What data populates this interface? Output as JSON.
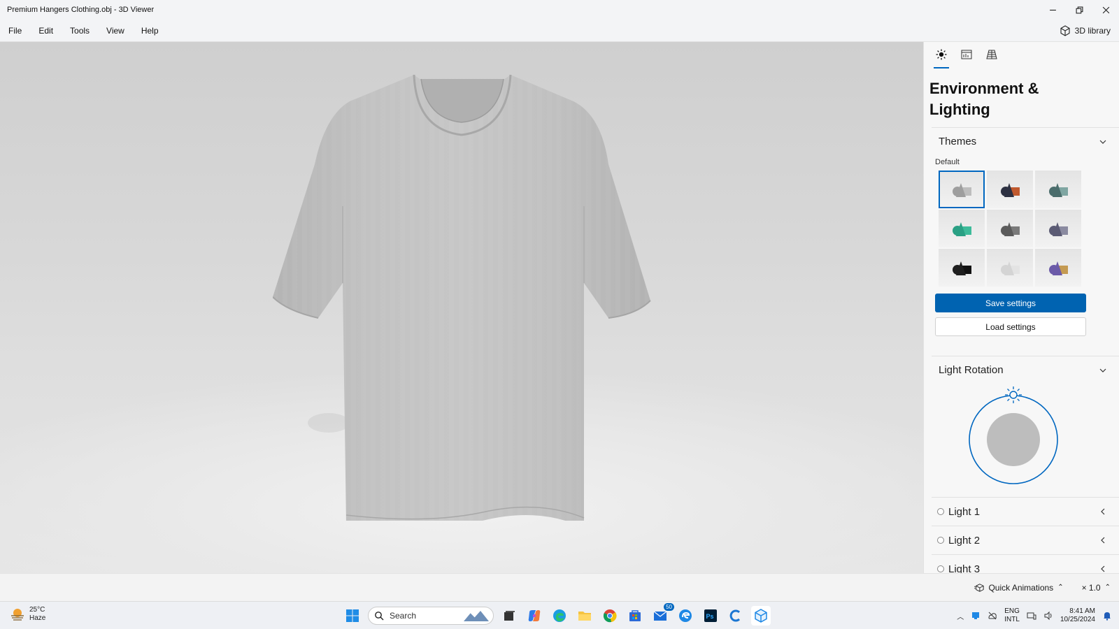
{
  "window": {
    "title": "Premium Hangers Clothing.obj - 3D Viewer",
    "controls": [
      "minimize",
      "restore",
      "close"
    ]
  },
  "menu": {
    "items": [
      "File",
      "Edit",
      "Tools",
      "View",
      "Help"
    ],
    "library_label": "3D library"
  },
  "panel": {
    "tabs": [
      "sun-icon",
      "stats-icon",
      "grid-icon"
    ],
    "title": "Environment & Lighting",
    "themes": {
      "label": "Themes",
      "subtitle": "Default",
      "items": [
        {
          "name": "theme-grey",
          "primary": "#9e9e9e",
          "secondary": "#bdbdbd"
        },
        {
          "name": "theme-dark-orange",
          "primary": "#2d3142",
          "secondary": "#c0592e"
        },
        {
          "name": "theme-teal-grey",
          "primary": "#4b6d6c",
          "secondary": "#7fa6a2"
        },
        {
          "name": "theme-green",
          "primary": "#2aa084",
          "secondary": "#3dbb9a"
        },
        {
          "name": "theme-dark-grey",
          "primary": "#5a5a5a",
          "secondary": "#7a7a7a"
        },
        {
          "name": "theme-purple-grey",
          "primary": "#5b5b74",
          "secondary": "#8a8aa0"
        },
        {
          "name": "theme-black",
          "primary": "#1e1e1e",
          "secondary": "#111111"
        },
        {
          "name": "theme-light",
          "primary": "#d4d4d4",
          "secondary": "#e3e3e3"
        },
        {
          "name": "theme-violet-gold",
          "primary": "#6b5aa8",
          "secondary": "#c49a52"
        }
      ],
      "selected_index": 0
    },
    "save_label": "Save settings",
    "load_label": "Load settings",
    "light_rotation": {
      "label": "Light Rotation"
    },
    "lights": [
      "Light 1",
      "Light 2",
      "Light 3"
    ]
  },
  "statusbar": {
    "quick_animations": "Quick Animations",
    "speed": "× 1.0"
  },
  "taskbar": {
    "weather_temp": "25°C",
    "weather_desc": "Haze",
    "search_placeholder": "Search",
    "apps": [
      "windows-start",
      "task-view",
      "copilot",
      "edge",
      "file-explorer",
      "chrome",
      "store",
      "mail",
      "edge-alt",
      "photoshop",
      "cortana",
      "3d-viewer"
    ],
    "mail_badge": "50",
    "lang_top": "ENG",
    "lang_bottom": "INTL",
    "time": "8:41 AM",
    "date": "10/25/2024"
  },
  "colors": {
    "accent": "#0067c0",
    "primary_button": "#0063b1"
  }
}
